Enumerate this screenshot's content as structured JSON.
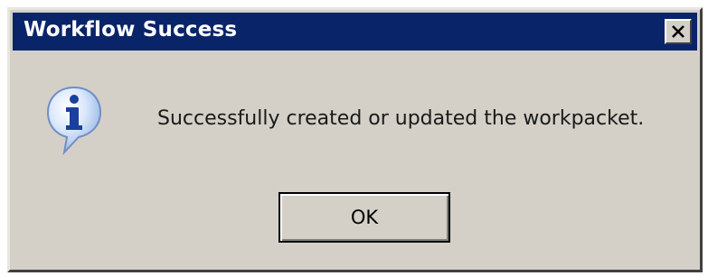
{
  "window": {
    "title": "Workflow Success",
    "close_label": "×"
  },
  "dialog": {
    "icon": "info-icon",
    "message": "Successfully created or updated the workpacket.",
    "ok_label": "OK"
  },
  "colors": {
    "titlebar": "#0a246a",
    "dialog_bg": "#d4d0c8",
    "title_text": "#ffffff"
  }
}
